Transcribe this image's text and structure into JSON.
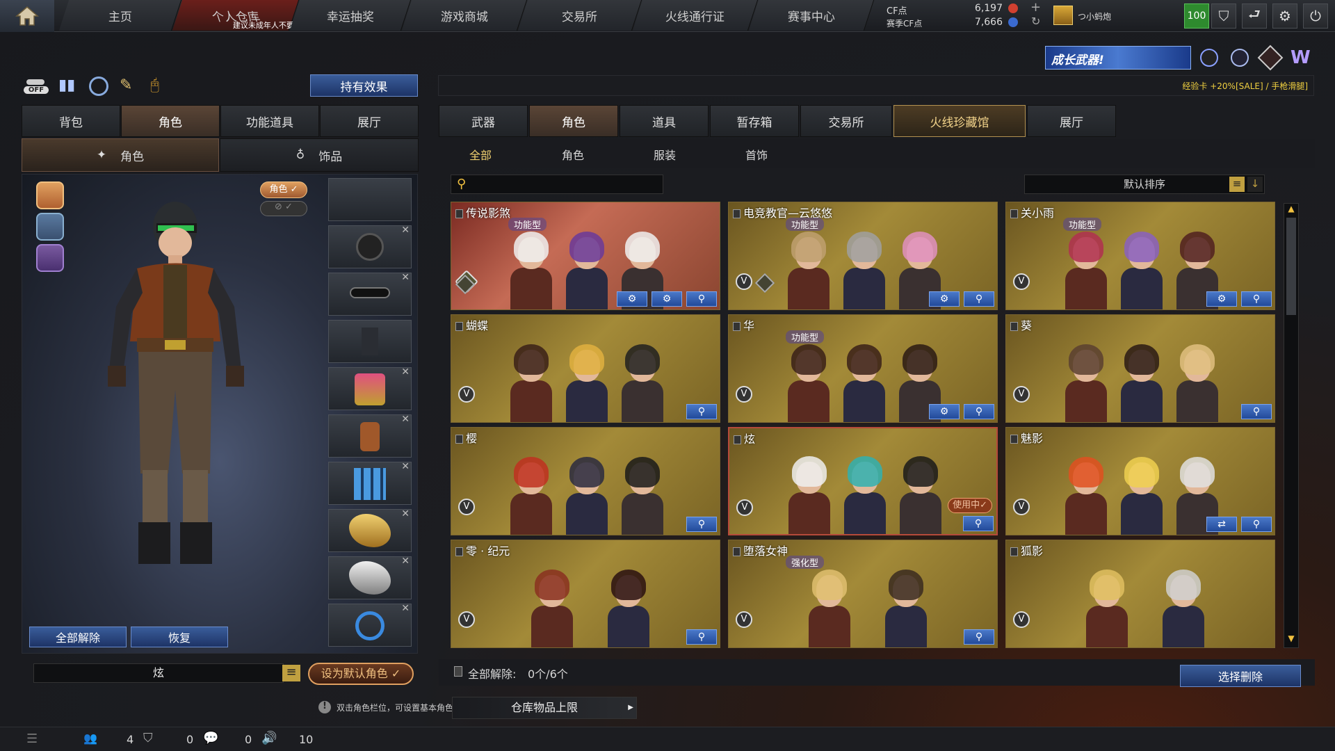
{
  "topnav": {
    "tabs": [
      "主页",
      "个人仓库",
      "幸运抽奖",
      "游戏商城",
      "交易所",
      "火线通行证",
      "赛事中心"
    ],
    "notice": "建议未成年人不要进入"
  },
  "currency": {
    "cf_label": "CF点",
    "cf_value": "6,197",
    "season_label": "赛季CF点",
    "season_value": "7,666"
  },
  "user": {
    "name": "つ小蚂炮",
    "level": "100"
  },
  "promo": {
    "banner": "成长武器!",
    "ticker": "经验卡 +20%[SALE] / 手枪滑腿]"
  },
  "left": {
    "effects_button": "持有效果",
    "tabs": [
      "背包",
      "角色",
      "功能道具",
      "展厅"
    ],
    "subtabs": [
      "角色",
      "饰品"
    ],
    "role_badge": "角色",
    "unequip_all": "全部解除",
    "restore": "恢复",
    "char_name": "炫",
    "set_default": "设为默认角色",
    "hint": "双击角色栏位，可设置基本角色。"
  },
  "right": {
    "tabs": [
      "武器",
      "角色",
      "道具",
      "暂存箱",
      "交易所",
      "火线珍藏馆",
      "展厅"
    ],
    "subtabs": [
      "全部",
      "角色",
      "服装",
      "首饰"
    ],
    "search_placeholder": "",
    "sort_label": "默认排序",
    "count_label": "全部解除:",
    "count_value": "0个/6个",
    "select_delete": "选择删除",
    "storage_limit": "仓库物品上限"
  },
  "cards": [
    {
      "name": "传说影煞",
      "func": "功能型",
      "in_use": ""
    },
    {
      "name": "电竞教官—云悠悠",
      "func": "功能型",
      "in_use": ""
    },
    {
      "name": "关小雨",
      "func": "功能型",
      "in_use": ""
    },
    {
      "name": "蝴蝶",
      "func": "",
      "in_use": ""
    },
    {
      "name": "华",
      "func": "功能型",
      "in_use": ""
    },
    {
      "name": "葵",
      "func": "",
      "in_use": ""
    },
    {
      "name": "樱",
      "func": "",
      "in_use": ""
    },
    {
      "name": "炫",
      "func": "",
      "in_use": "使用中"
    },
    {
      "name": "魅影",
      "func": "",
      "in_use": ""
    },
    {
      "name": "零 · 纪元",
      "func": "",
      "in_use": ""
    },
    {
      "name": "堕落女神",
      "func": "强化型",
      "in_use": ""
    },
    {
      "name": "狐影",
      "func": "",
      "in_use": ""
    }
  ],
  "statusbar": {
    "friends": "4",
    "guild": "0",
    "chat": "0",
    "volume": "10"
  },
  "colors": {
    "accent_gold": "#b39250",
    "active_red": "#6b1f1b",
    "button_blue": "#2a4a8a",
    "card_gold": "#a38a38"
  }
}
